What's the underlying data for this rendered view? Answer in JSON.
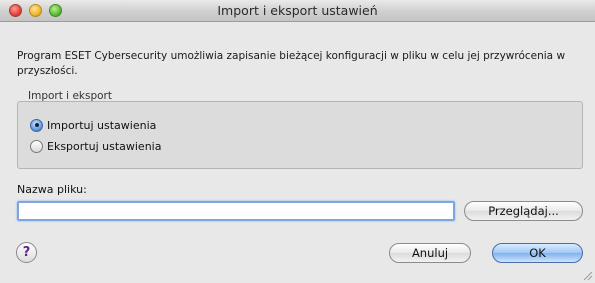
{
  "window": {
    "title": "Import i eksport ustawień",
    "controls": [
      "close",
      "minimize",
      "zoom"
    ]
  },
  "description": "Program ESET Cybersecurity umożliwia zapisanie bieżącej konfiguracji w pliku w celu jej przywrócenia w przyszłości.",
  "group": {
    "label": "Import i eksport",
    "options": [
      {
        "label": "Importuj ustawienia",
        "selected": true
      },
      {
        "label": "Eksportuj ustawienia",
        "selected": false
      }
    ]
  },
  "file": {
    "label": "Nazwa pliku:",
    "value": "",
    "browse_label": "Przeglądaj..."
  },
  "buttons": {
    "help_label": "?",
    "cancel_label": "Anuluj",
    "ok_label": "OK"
  }
}
